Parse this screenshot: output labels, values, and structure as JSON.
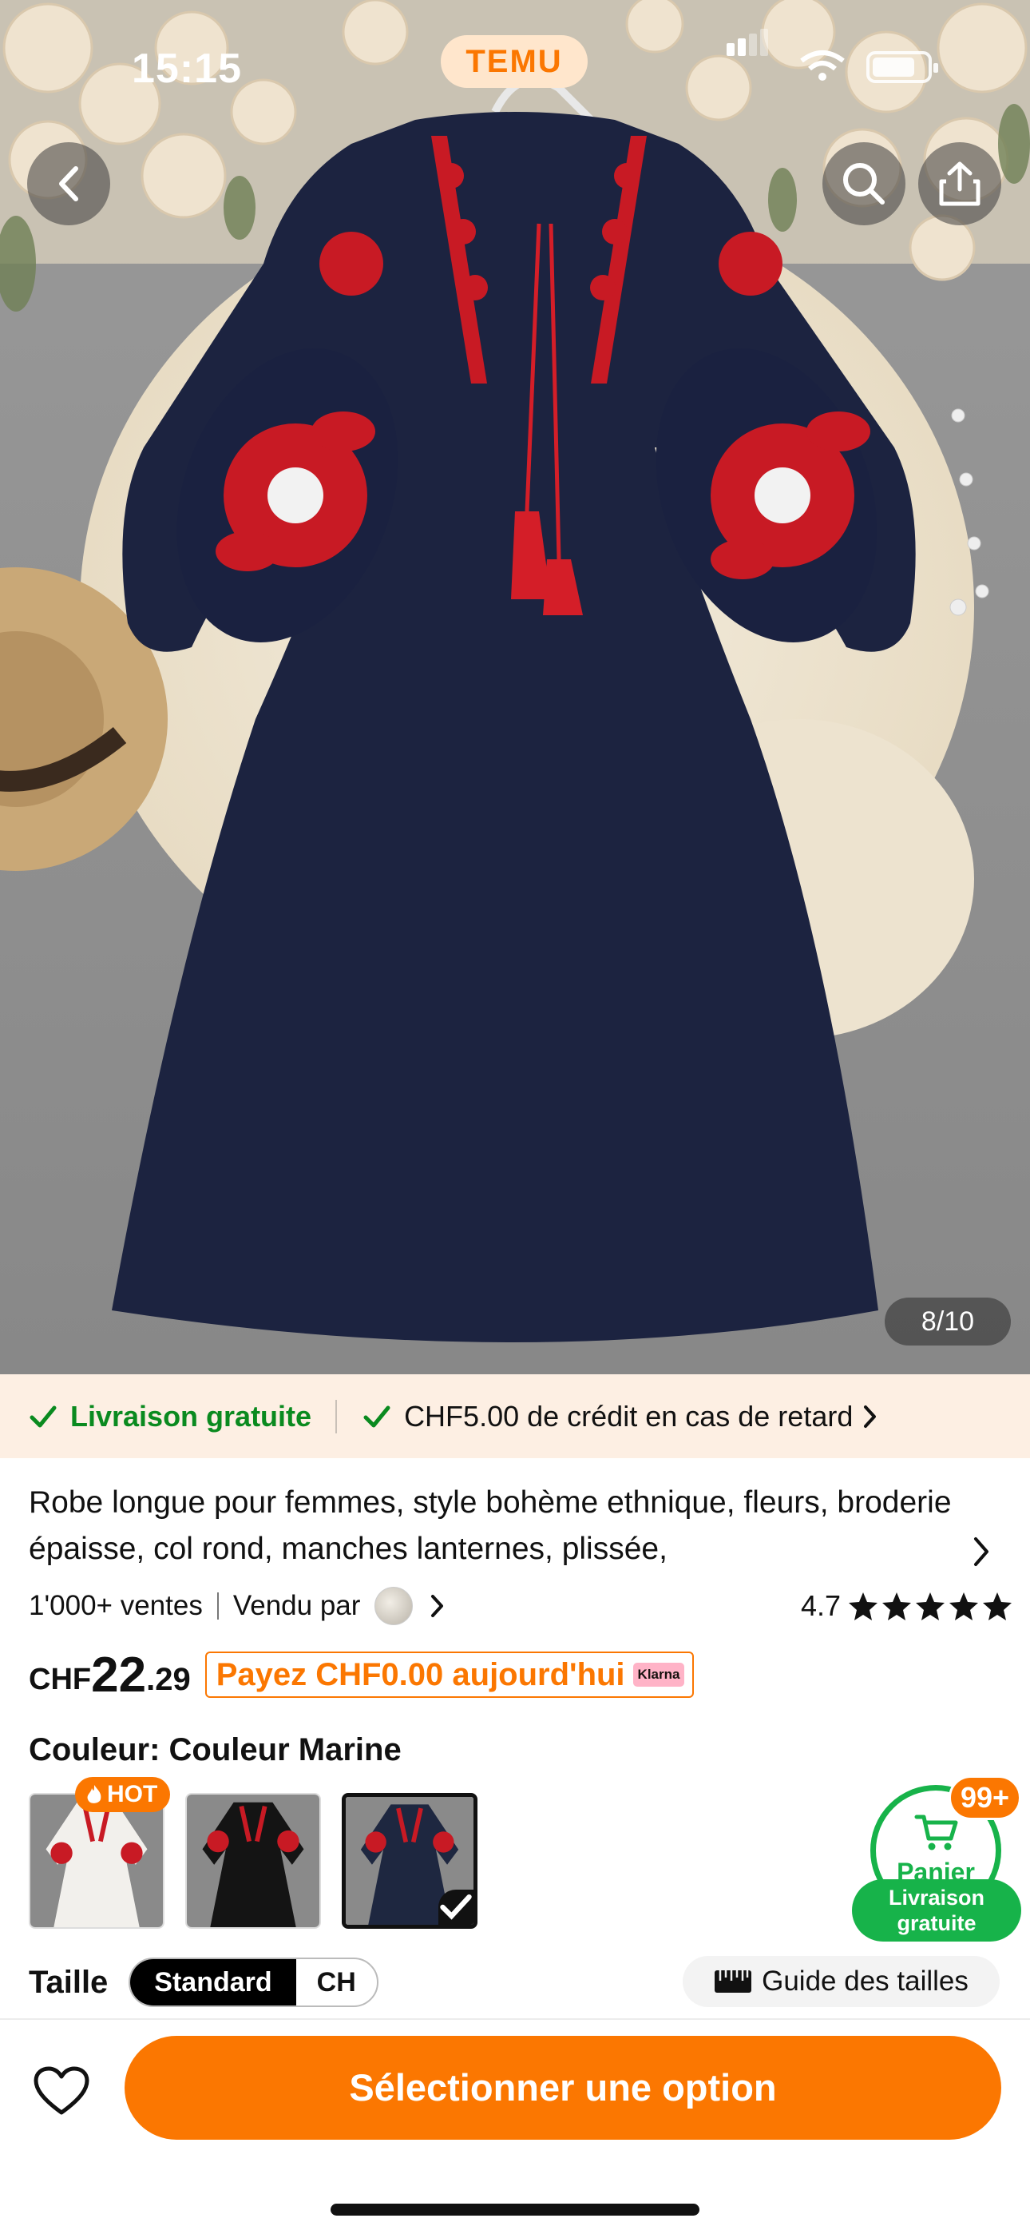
{
  "status_bar": {
    "time": "15:15",
    "brand": "TEMU"
  },
  "hero": {
    "image_counter": "8/10",
    "subject": "navy embroidered boho maxi dress"
  },
  "shipping_banner": {
    "free_shipping": "Livraison gratuite",
    "late_credit": "CHF5.00 de crédit en cas de retard"
  },
  "product": {
    "title": "Robe longue pour femmes, style bohème ethnique, fleurs, broderie épaisse, col rond, manches lanternes, plissée,",
    "sales": "1'000+ ventes",
    "sold_by": "Vendu par",
    "rating": "4.7",
    "stars": 5,
    "price": {
      "currency": "CHF",
      "integer": "22",
      "decimal": ".29"
    },
    "pay_today": "Payez CHF0.00 aujourd'hui",
    "klarna_label": "Klarna"
  },
  "color": {
    "label": "Couleur: Couleur Marine",
    "hot_badge": "HOT",
    "swatches": [
      {
        "name": "Blanc",
        "base": "#f2f0ec",
        "selected": false
      },
      {
        "name": "Noir",
        "base": "#141414",
        "selected": false
      },
      {
        "name": "Couleur Marine",
        "base": "#1e2740",
        "selected": true
      }
    ]
  },
  "cart": {
    "count": "99+",
    "label": "Panier",
    "free_line1": "Livraison",
    "free_line2": "gratuite"
  },
  "size": {
    "label": "Taille",
    "options": [
      "Standard",
      "CH"
    ],
    "active": "Standard",
    "guide": "Guide des tailles"
  },
  "bottom": {
    "cta": "Sélectionner une option"
  },
  "colors": {
    "accent": "#fb7701",
    "green": "#17b34a",
    "banner_bg": "#fdefe3"
  }
}
